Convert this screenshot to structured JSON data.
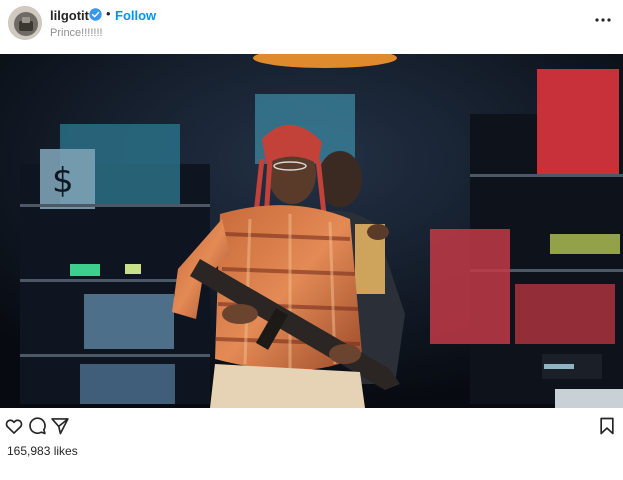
{
  "post": {
    "username": "lilgotit",
    "verified_icon": "verified-badge-icon",
    "separator": "•",
    "follow_label": "Follow",
    "subtitle": "Prince!!!!!!!",
    "more_icon": "more-options-icon"
  },
  "actions": {
    "like_icon": "heart-icon",
    "comment_icon": "comment-icon",
    "share_icon": "share-icon",
    "save_icon": "bookmark-icon"
  },
  "likes_text": "165,983 likes",
  "colors": {
    "link": "#0095f6",
    "text": "#262626",
    "muted": "#8e8e8e"
  }
}
